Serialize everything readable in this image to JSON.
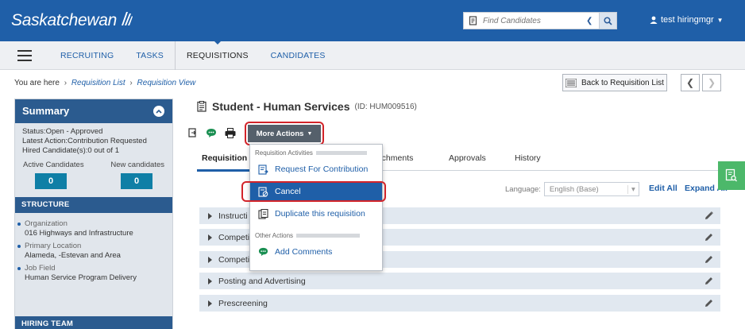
{
  "header": {
    "logo_text": "Saskatchewan",
    "search_placeholder": "Find Candidates",
    "user_name": "test hiringmgr"
  },
  "nav": {
    "items": [
      {
        "label": "RECRUITING"
      },
      {
        "label": "TASKS"
      },
      {
        "label": "REQUISITIONS"
      },
      {
        "label": "CANDIDATES"
      }
    ]
  },
  "breadcrumb": {
    "prefix": "You are here",
    "link1": "Requisition List",
    "current": "Requisition View"
  },
  "back_button": "Back to Requisition List",
  "summary": {
    "title": "Summary",
    "status_label": "Status:",
    "status_value": "Open - Approved",
    "latest_label": "Latest Action:",
    "latest_value": "Contribution Requested",
    "hired_label": "Hired Candidate(s):",
    "hired_value": "0 out of 1",
    "active_label": "Active Candidates",
    "new_label": "New candidates",
    "active_count": "0",
    "new_count": "0"
  },
  "structure": {
    "heading": "STRUCTURE",
    "items": [
      {
        "label": "Organization",
        "value": "016 Highways and Infrastructure"
      },
      {
        "label": "Primary Location",
        "value": "Alameda, -Estevan and Area"
      },
      {
        "label": "Job Field",
        "value": "Human Service Program Delivery"
      }
    ]
  },
  "hiring_team": {
    "heading": "HIRING TEAM"
  },
  "requisition": {
    "title": "Student - Human Services",
    "id_text": "(ID: HUM009516)"
  },
  "more_actions_label": "More Actions",
  "tabs": [
    {
      "label": "Requisition Info"
    },
    {
      "label": "Attachments"
    },
    {
      "label": "Approvals"
    },
    {
      "label": "History"
    }
  ],
  "tab_fragments": {
    "requisition": "Requisition Ir",
    "attachments": "ttachments"
  },
  "language": {
    "label": "Language:",
    "value": "English (Base)"
  },
  "edit_all": "Edit All",
  "expand_all": "Expand All",
  "sections": [
    {
      "label": "Instructi"
    },
    {
      "label": "Competi"
    },
    {
      "label": "Competi"
    },
    {
      "label": "Posting and Advertising"
    },
    {
      "label": "Prescreening"
    }
  ],
  "dropdown": {
    "group1": "Requisition Activities",
    "items1": [
      {
        "label": "Request For Contribution"
      },
      {
        "label": "Cancel"
      },
      {
        "label": "Duplicate this requisition"
      }
    ],
    "group2": "Other Actions",
    "items2": [
      {
        "label": "Add Comments"
      }
    ]
  },
  "colors": {
    "header_blue": "#1f5fa8",
    "summary_blue": "#2b5b8f",
    "count_teal": "#0f7fa6",
    "highlight_red": "#d2242a",
    "side_tab_green": "#4cb86a"
  }
}
